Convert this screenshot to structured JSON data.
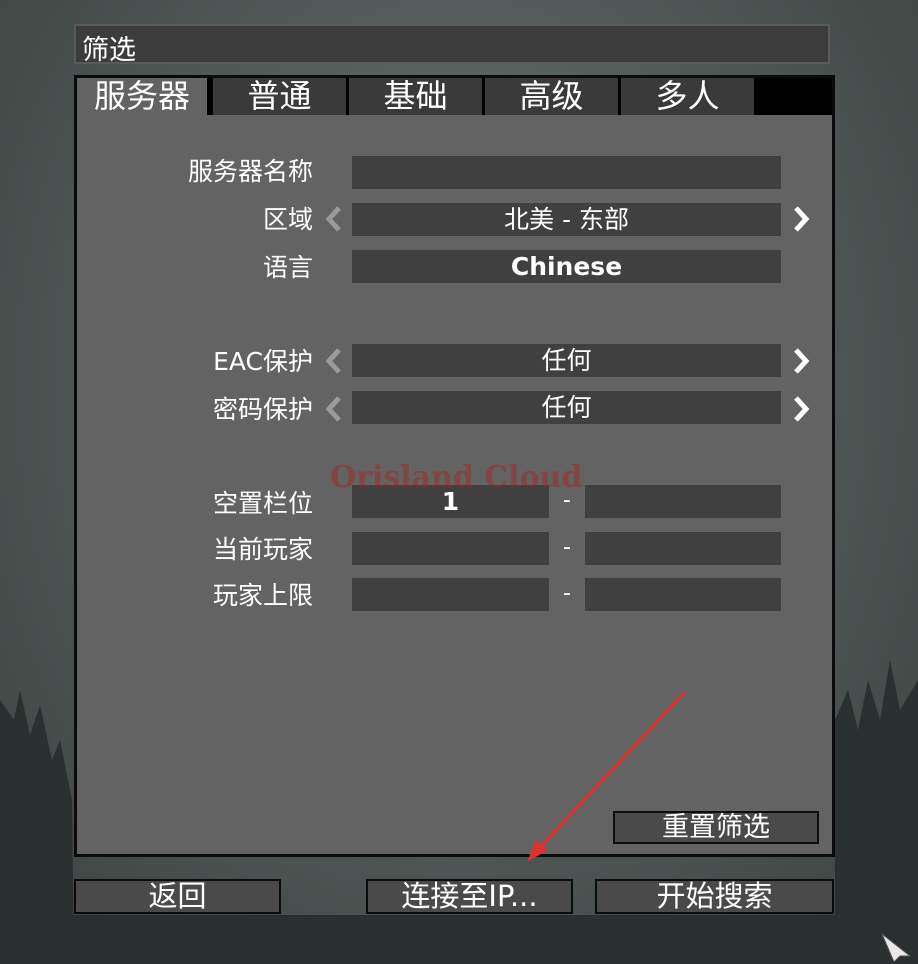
{
  "window_title": "筛选",
  "tabs": [
    {
      "label": "服务器"
    },
    {
      "label": "普通"
    },
    {
      "label": "基础"
    },
    {
      "label": "高级"
    },
    {
      "label": "多人"
    }
  ],
  "form": {
    "server_name": {
      "label": "服务器名称",
      "value": ""
    },
    "region": {
      "label": "区域",
      "value": "北美 - 东部"
    },
    "language": {
      "label": "语言",
      "value": "Chinese"
    },
    "eac": {
      "label": "EAC保护",
      "value": "任何"
    },
    "password": {
      "label": "密码保护",
      "value": "任何"
    },
    "free_slots": {
      "label": "空置栏位",
      "min": "1",
      "max": "",
      "sep": "-"
    },
    "current_players": {
      "label": "当前玩家",
      "min": "",
      "max": "",
      "sep": "-"
    },
    "max_players": {
      "label": "玩家上限",
      "min": "",
      "max": "",
      "sep": "-"
    }
  },
  "reset_label": "重置筛选",
  "buttons": {
    "back": "返回",
    "connect_ip": "连接至IP...",
    "start_search": "开始搜索"
  },
  "watermark": "Orisland Cloud",
  "colors": {
    "panel": "#636363",
    "field": "#404040",
    "arrow_annotation": "#e03030"
  }
}
